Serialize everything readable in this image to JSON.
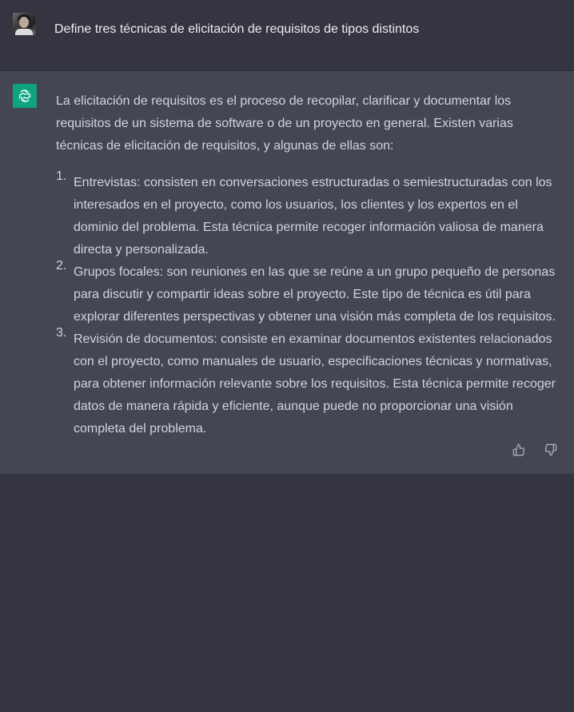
{
  "user": {
    "avatar": "user-avatar-photo",
    "message": "Define tres técnicas de elicitación de requisitos de tipos distintos"
  },
  "assistant": {
    "avatar_icon": "openai-logo-icon",
    "intro": "La elicitación de requisitos es el proceso de recopilar, clarificar y documentar los requisitos de un sistema de software o de un proyecto en general. Existen varias técnicas de elicitación de requisitos, y algunas de ellas son:",
    "items": [
      {
        "number": "1.",
        "text": "Entrevistas: consisten en conversaciones estructuradas o semiestructuradas con los interesados en el proyecto, como los usuarios, los clientes y los expertos en el dominio del problema. Esta técnica permite recoger información valiosa de manera directa y personalizada."
      },
      {
        "number": "2.",
        "text": "Grupos focales: son reuniones en las que se reúne a un grupo pequeño de personas para discutir y compartir ideas sobre el proyecto. Este tipo de técnica es útil para explorar diferentes perspectivas y obtener una visión más completa de los requisitos."
      },
      {
        "number": "3.",
        "text": "Revisión de documentos: consiste en examinar documentos existentes relacionados con el proyecto, como manuales de usuario, especificaciones técnicas y normativas, para obtener información relevante sobre los requisitos. Esta técnica permite recoger datos de manera rápida y eficiente, aunque puede no proporcionar una visión completa del problema."
      }
    ],
    "actions": {
      "thumbs_up_icon": "thumbs-up-icon",
      "thumbs_down_icon": "thumbs-down-icon"
    }
  },
  "colors": {
    "page_background": "#343541",
    "assistant_background": "#444654",
    "brand_green": "#10a37f",
    "user_text": "#ececf1",
    "assistant_text": "#d1d5db"
  }
}
